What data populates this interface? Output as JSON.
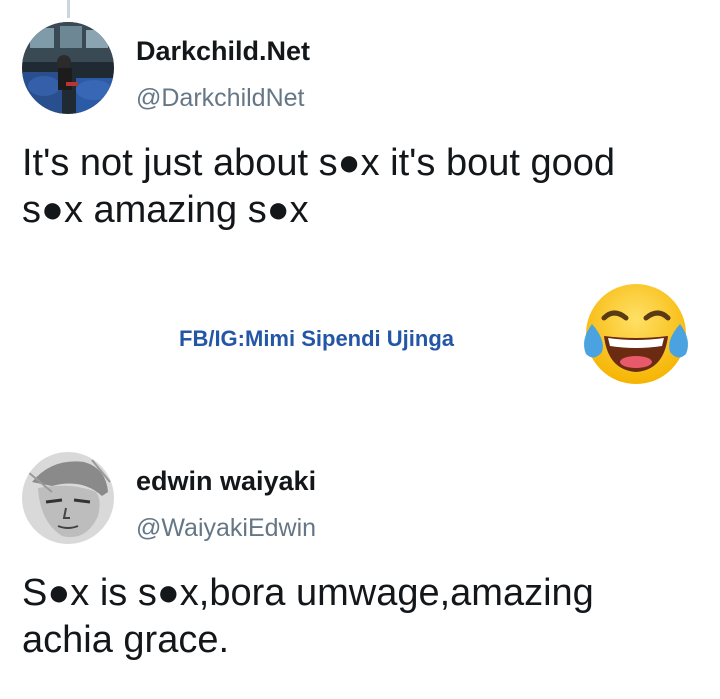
{
  "tweet_1": {
    "display_name": "Darkchild.Net",
    "handle": "@DarkchildNet",
    "text_line_1": "It's not just about s●x  it's bout good",
    "text_line_2": "s●x amazing s●x"
  },
  "watermark": "FB/IG:Mimi Sipendi Ujinga",
  "emoji": "face-with-tears-of-joy-icon",
  "tweet_2": {
    "display_name": "edwin waiyaki",
    "handle": "@WaiyakiEdwin",
    "text_line_1": "S●x is s●x,bora umwage,amazing",
    "text_line_2": "achia grace."
  },
  "colors": {
    "text": "#14171a",
    "handle": "#657786",
    "watermark": "#2456a6",
    "emoji_face": "#ffcc33",
    "emoji_tears": "#4aa3e0"
  }
}
